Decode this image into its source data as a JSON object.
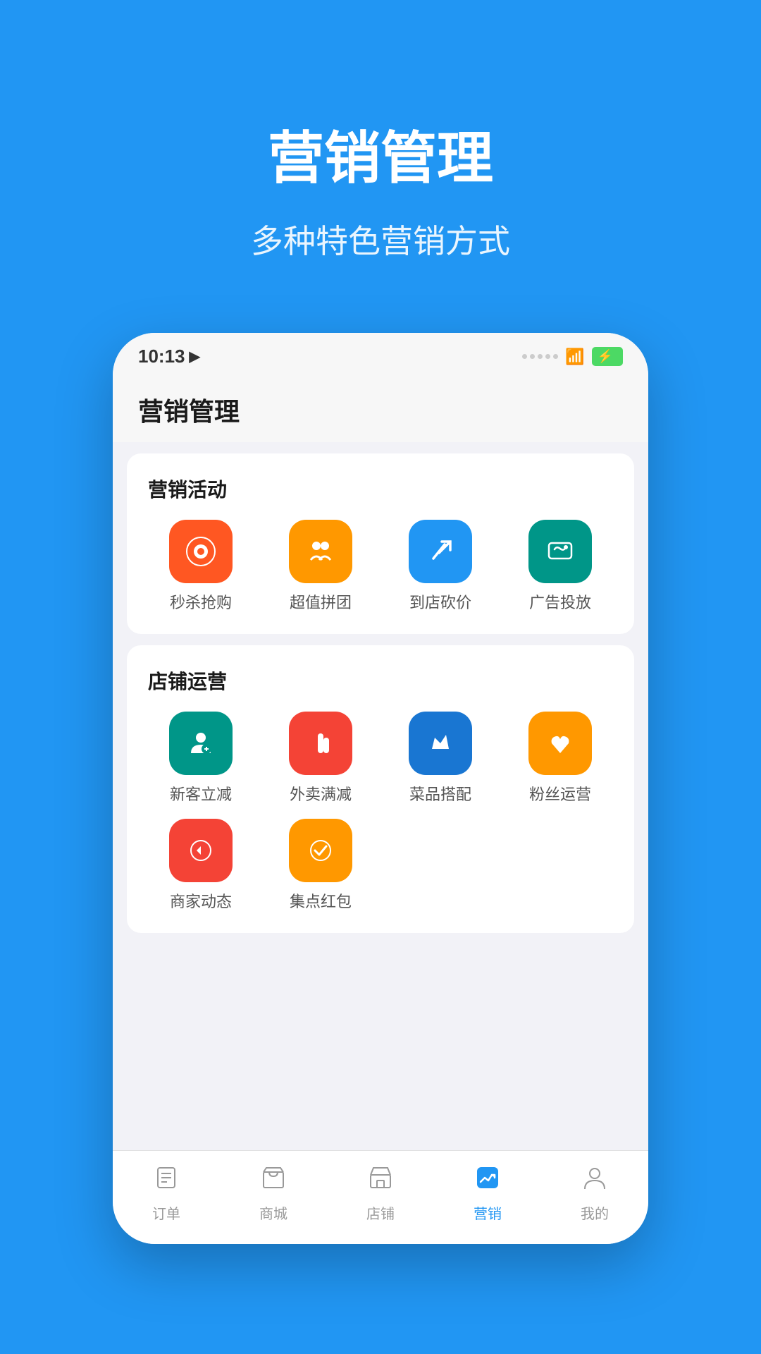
{
  "background_color": "#2196F3",
  "header": {
    "title": "营销管理",
    "subtitle": "多种特色营销方式"
  },
  "phone": {
    "status_bar": {
      "time": "10:13",
      "location_arrow": "➤"
    },
    "page_title": "营销管理",
    "sections": [
      {
        "id": "marketing-activities",
        "title": "营销活动",
        "items": [
          {
            "label": "秒杀抢购",
            "icon": "⚡",
            "color_class": "ic-red"
          },
          {
            "label": "超值拼团",
            "icon": "⚙",
            "color_class": "ic-orange"
          },
          {
            "label": "到店砍价",
            "icon": "✏",
            "color_class": "ic-blue"
          },
          {
            "label": "广告投放",
            "icon": "💬",
            "color_class": "ic-teal"
          }
        ]
      },
      {
        "id": "store-operations",
        "title": "店铺运营",
        "items": [
          {
            "label": "新客立减",
            "icon": "👤",
            "color_class": "ic-teal"
          },
          {
            "label": "外卖满减",
            "icon": "🍴",
            "color_class": "ic-red2"
          },
          {
            "label": "菜品搭配",
            "icon": "👍",
            "color_class": "ic-blue2"
          },
          {
            "label": "粉丝运营",
            "icon": "❤",
            "color_class": "ic-orange2"
          },
          {
            "label": "商家动态",
            "icon": "▶",
            "color_class": "ic-red2"
          },
          {
            "label": "集点红包",
            "icon": "✔",
            "color_class": "ic-orange2"
          }
        ]
      }
    ],
    "bottom_nav": [
      {
        "label": "订单",
        "icon": "📋",
        "active": false
      },
      {
        "label": "商城",
        "icon": "🛍",
        "active": false
      },
      {
        "label": "店铺",
        "icon": "🏪",
        "active": false
      },
      {
        "label": "营销",
        "icon": "📈",
        "active": true
      },
      {
        "label": "我的",
        "icon": "👤",
        "active": false
      }
    ]
  }
}
